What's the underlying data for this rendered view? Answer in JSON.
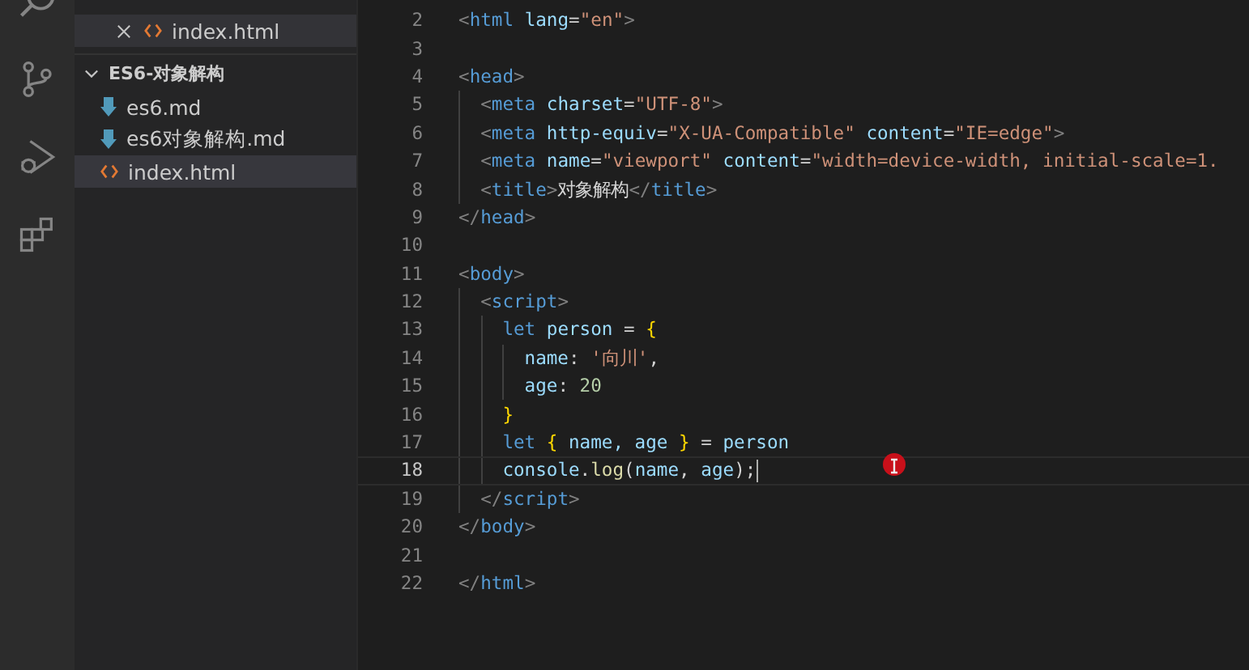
{
  "open_editors": [
    {
      "label": "index.html",
      "selected": true
    }
  ],
  "folder": {
    "label": "ES6-对象解构",
    "expanded": true,
    "files": [
      {
        "label": "es6.md",
        "kind": "markdown",
        "selected": false
      },
      {
        "label": "es6对象解构.md",
        "kind": "markdown",
        "selected": false
      },
      {
        "label": "index.html",
        "kind": "html",
        "selected": true
      }
    ]
  },
  "editor": {
    "lines": [
      {
        "number": "2",
        "active": false,
        "tokens": [
          {
            "t": "<",
            "kind": "p"
          },
          {
            "t": "html",
            "kind": "tag"
          },
          {
            "t": " lang",
            "kind": "attr"
          },
          {
            "t": "=",
            "kind": "x"
          },
          {
            "t": "\"en\"",
            "kind": "str"
          },
          {
            "t": ">",
            "kind": "p"
          }
        ]
      },
      {
        "number": "3",
        "active": false
      },
      {
        "number": "4",
        "active": false,
        "tokens": [
          {
            "t": "<",
            "kind": "p"
          },
          {
            "t": "head",
            "kind": "tag"
          },
          {
            "t": ">",
            "kind": "p"
          }
        ],
        "children": [
          {
            "number": "5",
            "active": false,
            "tokens": [
              {
                "t": "<",
                "kind": "p"
              },
              {
                "t": "meta",
                "kind": "tag"
              },
              {
                "t": " charset",
                "kind": "attr"
              },
              {
                "t": "=",
                "kind": "x"
              },
              {
                "t": "\"UTF-8\"",
                "kind": "str"
              },
              {
                "t": ">",
                "kind": "p"
              }
            ]
          },
          {
            "number": "6",
            "active": false,
            "tokens": [
              {
                "t": "<",
                "kind": "p"
              },
              {
                "t": "meta",
                "kind": "tag"
              },
              {
                "t": " http-equiv",
                "kind": "attr"
              },
              {
                "t": "=",
                "kind": "x"
              },
              {
                "t": "\"X-UA-Compatible\"",
                "kind": "str"
              },
              {
                "t": " content",
                "kind": "attr"
              },
              {
                "t": "=",
                "kind": "x"
              },
              {
                "t": "\"IE=edge\"",
                "kind": "str"
              },
              {
                "t": ">",
                "kind": "p"
              }
            ]
          },
          {
            "number": "7",
            "active": false,
            "tokens": [
              {
                "t": "<",
                "kind": "p"
              },
              {
                "t": "meta",
                "kind": "tag"
              },
              {
                "t": " name",
                "kind": "attr"
              },
              {
                "t": "=",
                "kind": "x"
              },
              {
                "t": "\"viewport\"",
                "kind": "str"
              },
              {
                "t": " content",
                "kind": "attr"
              },
              {
                "t": "=",
                "kind": "x"
              },
              {
                "t": "\"width=device-width, initial-scale=1.",
                "kind": "str"
              }
            ]
          },
          {
            "number": "8",
            "active": false,
            "tokens": [
              {
                "t": "<",
                "kind": "p"
              },
              {
                "t": "title",
                "kind": "tag"
              },
              {
                "t": ">",
                "kind": "p"
              },
              {
                "t": "对象解构",
                "kind": "x"
              },
              {
                "t": "</",
                "kind": "p"
              },
              {
                "t": "title",
                "kind": "tag"
              },
              {
                "t": ">",
                "kind": "p"
              }
            ]
          }
        ]
      },
      {
        "number": "9",
        "active": false,
        "tokens": [
          {
            "t": "</",
            "kind": "p"
          },
          {
            "t": "head",
            "kind": "tag"
          },
          {
            "t": ">",
            "kind": "p"
          }
        ]
      },
      {
        "number": "10",
        "active": false
      },
      {
        "number": "11",
        "active": false,
        "tokens": [
          {
            "t": "<",
            "kind": "p"
          },
          {
            "t": "body",
            "kind": "tag"
          },
          {
            "t": ">",
            "kind": "p"
          }
        ],
        "children": [
          {
            "number": "12",
            "active": false,
            "tokens": [
              {
                "t": "<",
                "kind": "p"
              },
              {
                "t": "script",
                "kind": "tag"
              },
              {
                "t": ">",
                "kind": "p"
              }
            ],
            "children": [
              {
                "number": "13",
                "active": false,
                "tokens": [
                  {
                    "t": "let",
                    "kind": "kw"
                  },
                  {
                    "t": " person",
                    "kind": "var"
                  },
                  {
                    "t": " = ",
                    "kind": "x"
                  },
                  {
                    "t": "{",
                    "kind": "brace"
                  }
                ],
                "children": [
                  {
                    "number": "14",
                    "active": false,
                    "tokens": [
                      {
                        "t": "name",
                        "kind": "var"
                      },
                      {
                        "t": ": ",
                        "kind": "x"
                      },
                      {
                        "t": "'向川'",
                        "kind": "str"
                      },
                      {
                        "t": ",",
                        "kind": "x"
                      }
                    ]
                  },
                  {
                    "number": "15",
                    "active": false,
                    "tokens": [
                      {
                        "t": "age",
                        "kind": "var"
                      },
                      {
                        "t": ": ",
                        "kind": "x"
                      },
                      {
                        "t": "20",
                        "kind": "num"
                      }
                    ]
                  }
                ]
              },
              {
                "number": "16",
                "active": false,
                "tokens": [
                  {
                    "t": "}",
                    "kind": "brace"
                  }
                ]
              },
              {
                "number": "17",
                "active": false,
                "tokens": [
                  {
                    "t": "let",
                    "kind": "kw"
                  },
                  {
                    "t": " {",
                    "kind": "brace"
                  },
                  {
                    "t": " name, age ",
                    "kind": "var"
                  },
                  {
                    "t": "}",
                    "kind": "brace"
                  },
                  {
                    "t": " = ",
                    "kind": "x"
                  },
                  {
                    "t": "person",
                    "kind": "var"
                  }
                ]
              },
              {
                "number": "18",
                "active": true,
                "tokens": [
                  {
                    "t": "console",
                    "kind": "var"
                  },
                  {
                    "t": ".",
                    "kind": "x"
                  },
                  {
                    "t": "log",
                    "kind": "fn"
                  },
                  {
                    "t": "(",
                    "kind": "x"
                  },
                  {
                    "t": "name",
                    "kind": "var"
                  },
                  {
                    "t": ", ",
                    "kind": "x"
                  },
                  {
                    "t": "age",
                    "kind": "var"
                  },
                  {
                    "t": ");",
                    "kind": "x"
                  }
                ]
              }
            ]
          },
          {
            "number": "19",
            "active": false,
            "tokens": [
              {
                "t": "</",
                "kind": "p"
              },
              {
                "t": "script",
                "kind": "tag"
              },
              {
                "t": ">",
                "kind": "p"
              }
            ]
          }
        ]
      },
      {
        "number": "20",
        "active": false,
        "tokens": [
          {
            "t": "</",
            "kind": "p"
          },
          {
            "t": "body",
            "kind": "tag"
          },
          {
            "t": ">",
            "kind": "p"
          }
        ]
      },
      {
        "number": "21",
        "active": false
      },
      {
        "number": "22",
        "active": false,
        "tokens": [
          {
            "t": "</",
            "kind": "p"
          },
          {
            "t": "html",
            "kind": "tag"
          },
          {
            "t": ">",
            "kind": "p"
          }
        ]
      }
    ]
  }
}
